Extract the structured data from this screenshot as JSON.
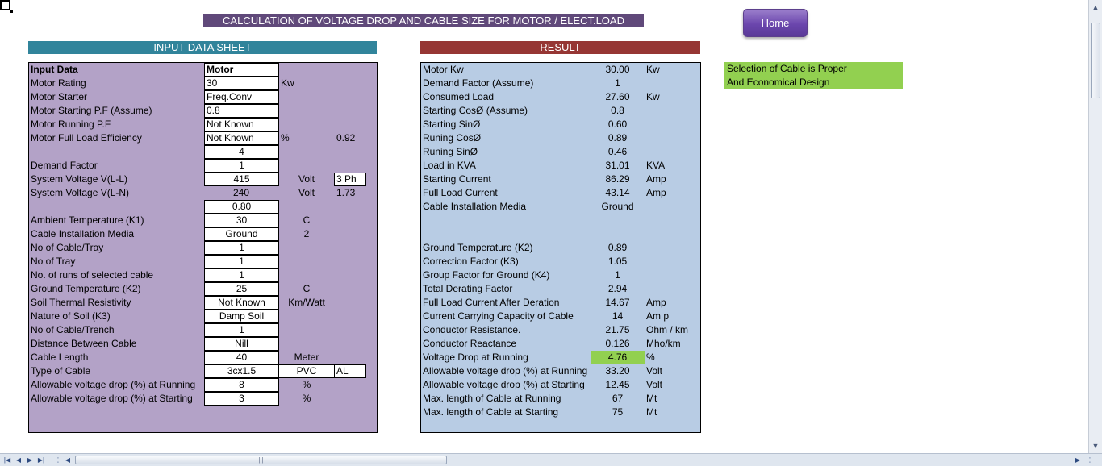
{
  "title": "CALCULATION OF VOLTAGE DROP AND CABLE SIZE FOR MOTOR / ELECT.LOAD",
  "home_label": "Home",
  "input_header": "INPUT DATA SHEET",
  "result_header": "RESULT",
  "status": {
    "line1": "Selection of Cable is Proper",
    "line2": "And Economical Design",
    "color": "#92d050"
  },
  "input_rows": [
    {
      "label": "Input Data",
      "value": "Motor",
      "unit": "",
      "extra": "",
      "bold": true,
      "align": "left"
    },
    {
      "label": "Motor Rating",
      "value": "30",
      "unit": "Kw",
      "extra": "",
      "align": "left"
    },
    {
      "label": "Motor Starter",
      "value": "Freq.Conv",
      "unit": "",
      "extra": "",
      "align": "left"
    },
    {
      "label": "Motor Starting P.F (Assume)",
      "value": "0.8",
      "unit": "",
      "extra": "",
      "align": "left"
    },
    {
      "label": "Motor Running P.F",
      "value": "Not Known",
      "unit": "",
      "extra": "",
      "align": "left"
    },
    {
      "label": "Motor Full Load Efficiency",
      "value": "Not Known",
      "unit": "%",
      "extra": "0.92",
      "align": "left"
    },
    {
      "label": "",
      "value": "4",
      "unit": "",
      "extra": "",
      "align": "center"
    },
    {
      "label": "Demand Factor",
      "value": "1",
      "unit": "",
      "extra": "",
      "align": "center"
    },
    {
      "label": "System Voltage  V(L-L)",
      "value": "415",
      "unit": "Volt",
      "extra": "3 Ph",
      "extra_box": true,
      "align": "center"
    },
    {
      "label": "System Voltage  V(L-N)",
      "value": "240",
      "unit": "Volt",
      "extra": "1.73",
      "plain_value": true,
      "align": "center"
    },
    {
      "label": "",
      "value": "0.80",
      "unit": "",
      "extra": "",
      "align": "center"
    },
    {
      "label": "Ambient Temperature (K1)",
      "value": "30",
      "unit": "C",
      "extra": "",
      "align": "center"
    },
    {
      "label": "Cable Installation Media",
      "value": "Ground",
      "unit": "2",
      "extra": "",
      "align": "center"
    },
    {
      "label": "No of Cable/Tray",
      "value": "1",
      "unit": "",
      "extra": "",
      "align": "center"
    },
    {
      "label": "No of Tray",
      "value": "1",
      "unit": "",
      "extra": "",
      "align": "center"
    },
    {
      "label": "No. of runs of selected cable",
      "value": "1",
      "unit": "",
      "extra": "",
      "align": "center"
    },
    {
      "label": "Ground Temperature (K2)",
      "value": "25",
      "unit": "C",
      "extra": "",
      "align": "center"
    },
    {
      "label": "Soil Thermal Resistivity",
      "value": "Not Known",
      "unit": "Km/Watt",
      "extra": "",
      "align": "center"
    },
    {
      "label": "Nature of Soil (K3)",
      "value": "Damp Soil",
      "unit": "",
      "extra": "",
      "align": "center"
    },
    {
      "label": "No of Cable/Trench",
      "value": "1",
      "unit": "",
      "extra": "",
      "align": "center"
    },
    {
      "label": "Distance Between Cable",
      "value": "Nill",
      "unit": "",
      "extra": "",
      "align": "center"
    },
    {
      "label": "Cable Length",
      "value": "40",
      "unit": "Meter",
      "extra": "",
      "plain_unit": true,
      "align": "center"
    },
    {
      "label": "Type of Cable",
      "value": "3cx1.5",
      "unit": "PVC",
      "unit_box": true,
      "extra": "AL",
      "extra_box": true,
      "align": "center"
    },
    {
      "label": "Allowable voltage drop (%) at Running",
      "value": "8",
      "unit": "%",
      "extra": "",
      "align": "center"
    },
    {
      "label": "Allowable voltage drop (%) at Starting",
      "value": "3",
      "unit": "%",
      "extra": "",
      "align": "center"
    }
  ],
  "result_rows": [
    {
      "label": "Motor Kw",
      "value": "30.00",
      "unit": "Kw"
    },
    {
      "label": "Demand Factor (Assume)",
      "value": "1",
      "unit": ""
    },
    {
      "label": "Consumed Load",
      "value": "27.60",
      "unit": "Kw"
    },
    {
      "label": "Starting CosØ  (Assume)",
      "value": "0.8",
      "unit": ""
    },
    {
      "label": "Starting SinØ",
      "value": "0.60",
      "unit": ""
    },
    {
      "label": "Runing CosØ",
      "value": "0.89",
      "unit": ""
    },
    {
      "label": "Runing SinØ",
      "value": "0.46",
      "unit": ""
    },
    {
      "label": "Load in  KVA",
      "value": "31.01",
      "unit": "KVA"
    },
    {
      "label": "Starting Current",
      "value": "86.29",
      "unit": "Amp"
    },
    {
      "label": "Full Load Current",
      "value": "43.14",
      "unit": "Amp"
    },
    {
      "label": "Cable Installation Media",
      "value": "Ground",
      "unit": ""
    },
    {
      "label": "",
      "value": "",
      "unit": ""
    },
    {
      "label": "",
      "value": "",
      "unit": ""
    },
    {
      "label": "Ground Temperature (K2)",
      "value": "0.89",
      "unit": ""
    },
    {
      "label": "Correction Factor (K3)",
      "value": "1.05",
      "unit": ""
    },
    {
      "label": "Group Factor for Ground (K4)",
      "value": "1",
      "unit": ""
    },
    {
      "label": "Total Derating Factor",
      "value": "2.94",
      "unit": ""
    },
    {
      "label": "Full Load Current After Deration",
      "value": "14.67",
      "unit": "Amp"
    },
    {
      "label": "Current Carrying Capacity of Cable",
      "value": "14",
      "unit": "Am p"
    },
    {
      "label": "Conductor Resistance.",
      "value": "21.75",
      "unit": "Ohm / km"
    },
    {
      "label": "Conductor Reactance",
      "value": "0.126",
      "unit": "Mho/km"
    },
    {
      "label": "Voltage Drop at Running",
      "value": "4.76",
      "unit": "%",
      "highlight": true
    },
    {
      "label": "Allowable voltage drop (%) at Running",
      "value": "33.20",
      "unit": "Volt"
    },
    {
      "label": "Allowable voltage drop (%) at Starting",
      "value": "12.45",
      "unit": "Volt"
    },
    {
      "label": "Max. length of Cable at Running",
      "value": "67",
      "unit": "Mt"
    },
    {
      "label": "Max. length of Cable at Starting",
      "value": "75",
      "unit": "Mt"
    }
  ],
  "colors": {
    "title_bg": "#60497a",
    "input_header_bg": "#31849b",
    "result_header_bg": "#963634",
    "input_panel_bg": "#b3a2c7",
    "result_panel_bg": "#b8cce4",
    "highlight": "#92d050"
  },
  "icons": {
    "nav": [
      "first-sheet-icon",
      "prev-sheet-icon",
      "next-sheet-icon",
      "last-sheet-icon"
    ],
    "scroll": [
      "scroll-up-icon",
      "scroll-down-icon",
      "scroll-left-icon",
      "scroll-right-icon"
    ]
  }
}
